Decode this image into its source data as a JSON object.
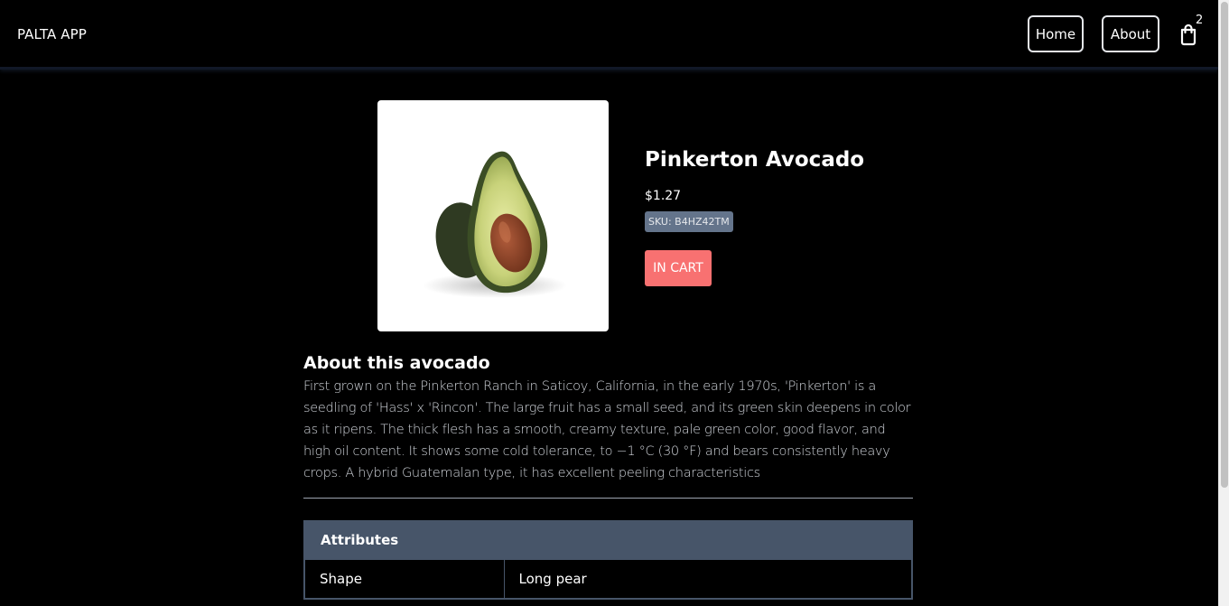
{
  "app": {
    "brand": "PALTA APP"
  },
  "nav": {
    "home_label": "Home",
    "about_label": "About",
    "cart_count": "2"
  },
  "product": {
    "title": "Pinkerton Avocado",
    "price": "$1.27",
    "sku": "SKU: B4HZ42TM",
    "cart_button_label": "IN CART",
    "image_alt": "Pinkerton Avocado"
  },
  "about": {
    "heading": "About this avocado",
    "text": "First grown on the Pinkerton Ranch in Saticoy, California, in the early 1970s, 'Pinkerton' is a seedling of 'Hass' x 'Rincon'. The large fruit has a small seed, and its green skin deepens in color as it ripens. The thick flesh has a smooth, creamy texture, pale green color, good flavor, and high oil content. It shows some cold tolerance, to −1 °C (30 °F) and bears consistently heavy crops. A hybrid Guatemalan type, it has excellent peeling characteristics"
  },
  "attributes": {
    "header": "Attributes",
    "rows": [
      {
        "key": "Shape",
        "value": "Long pear"
      }
    ]
  },
  "colors": {
    "background": "#000000",
    "accent_button": "#f87171",
    "badge": "#64748b",
    "table_header": "#475569"
  },
  "icons": {
    "cart": "shopping-bag-icon"
  }
}
